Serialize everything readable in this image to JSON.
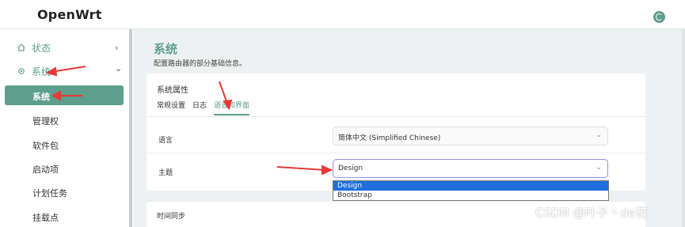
{
  "app": {
    "brand": "OpenWrt"
  },
  "sidebar": {
    "status": {
      "label": "状态",
      "arrow": "›"
    },
    "system": {
      "label": "系统",
      "arrow": "⌄"
    },
    "sub_items": [
      {
        "label": "系统",
        "active": true
      },
      {
        "label": "管理权"
      },
      {
        "label": "软件包"
      },
      {
        "label": "启动项"
      },
      {
        "label": "计划任务"
      },
      {
        "label": "挂载点"
      }
    ]
  },
  "page": {
    "title": "系统",
    "description": "配置路由器的部分基础信息。"
  },
  "card": {
    "title": "系统属性",
    "tabs": [
      {
        "label": "常规设置"
      },
      {
        "label": "日志"
      },
      {
        "label": "语言和界面",
        "active": true
      }
    ],
    "language": {
      "label": "语言",
      "value": "简体中文 (Simplified Chinese)"
    },
    "theme": {
      "label": "主题",
      "value": "Design",
      "options": [
        "Design",
        "Bootstrap"
      ]
    }
  },
  "card2": {
    "title": "时间同步"
  },
  "watermark": "CSDN @叶子丶de花",
  "colors": {
    "accent": "#5e9e8c",
    "highlight": "#1e6fdc",
    "annotation": "#e53935"
  }
}
